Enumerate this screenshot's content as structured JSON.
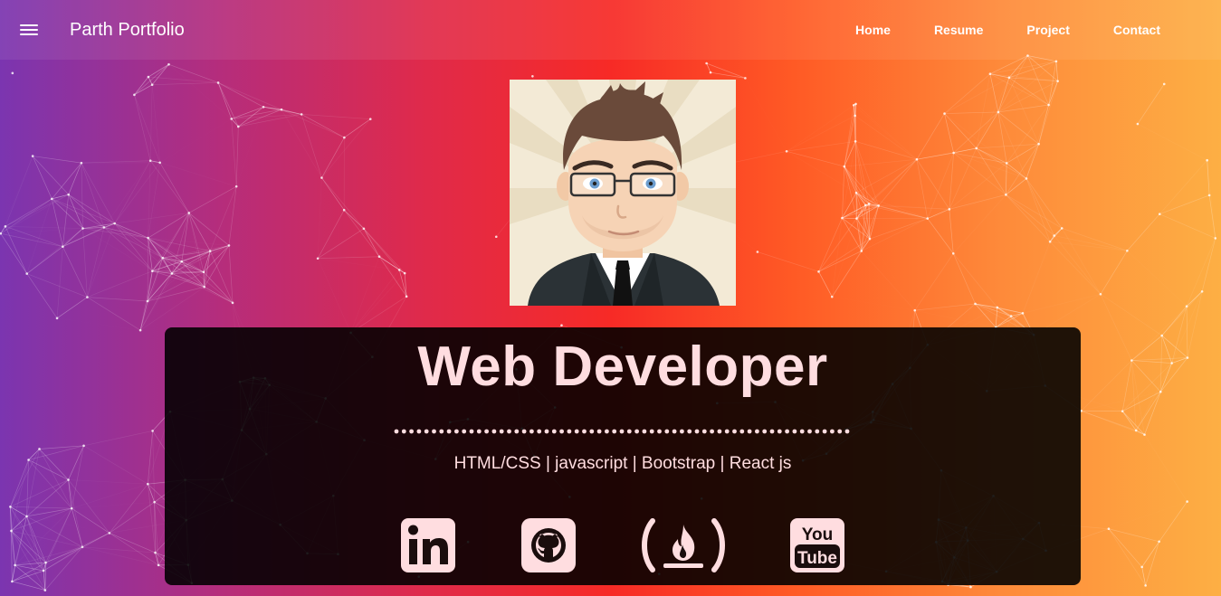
{
  "header": {
    "brand": "Parth Portfolio",
    "nav": [
      {
        "label": "Home"
      },
      {
        "label": "Resume"
      },
      {
        "label": "Project"
      },
      {
        "label": "Contact"
      }
    ]
  },
  "hero": {
    "title": "Web Developer",
    "skills": "HTML/CSS | javascript | Bootstrap | React js"
  },
  "social": [
    {
      "name": "linkedin-icon",
      "text": "in"
    },
    {
      "name": "github-icon"
    },
    {
      "name": "freecodecamp-icon"
    },
    {
      "name": "youtube-icon",
      "text_top": "You",
      "text_bottom": "Tube"
    }
  ],
  "colors": {
    "accent_text": "#ffdde0",
    "gradient_start": "#7b35b0",
    "gradient_mid": "#f72a26",
    "gradient_end": "#fdaf44"
  }
}
